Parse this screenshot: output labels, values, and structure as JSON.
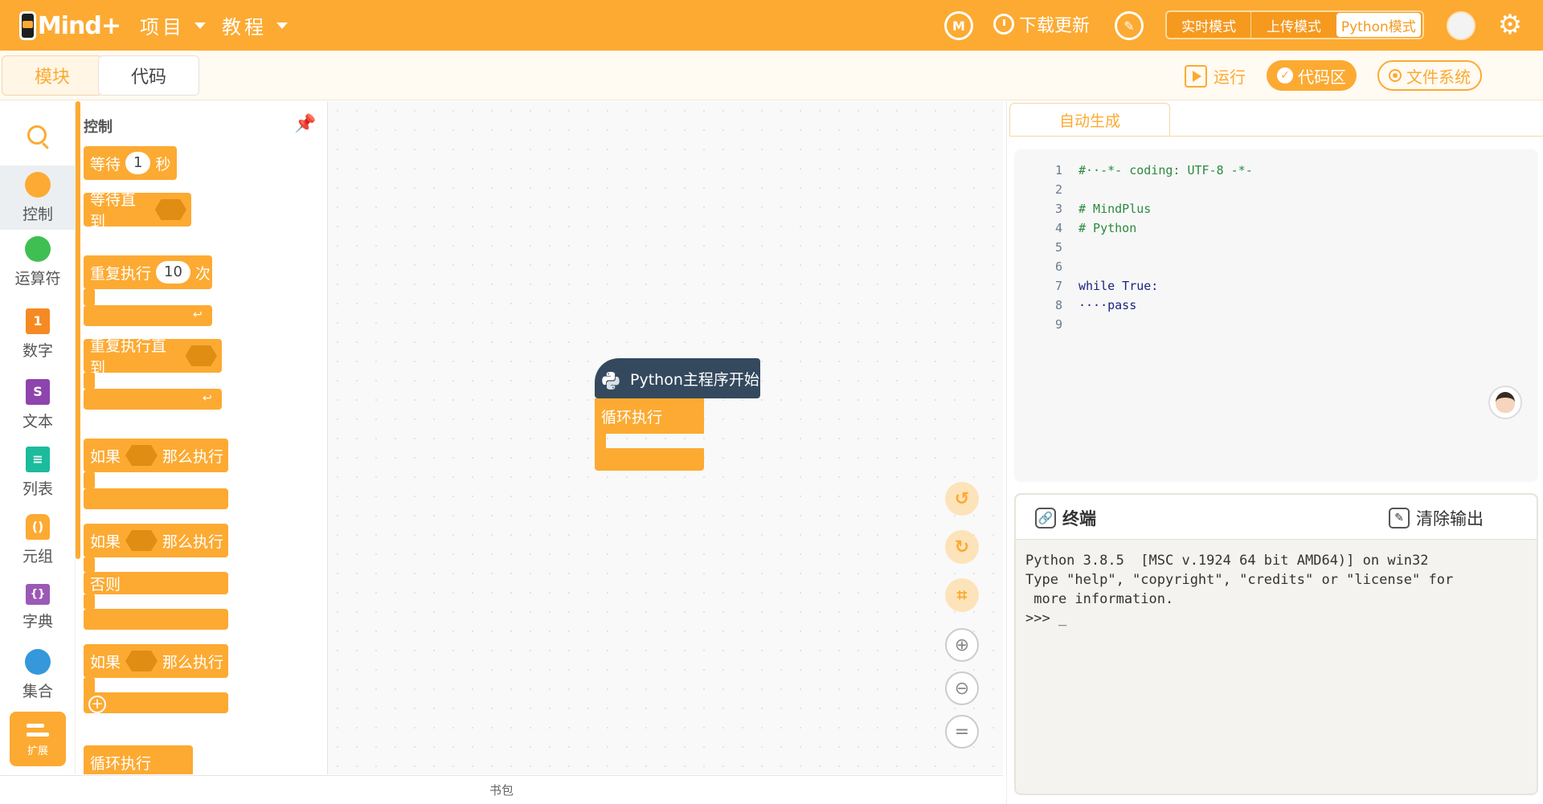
{
  "app": {
    "logo_text": "Mind+",
    "menus": [
      {
        "label": "项目"
      },
      {
        "label": "教程"
      }
    ],
    "update_label": "下载更新",
    "modes": {
      "realtime": "实时模式",
      "upload": "上传模式",
      "python": "Python模式",
      "active": "python"
    }
  },
  "subbar": {
    "tab_blocks": "模块",
    "tab_code": "代码",
    "run_label": "运行",
    "code_area_label": "代码区",
    "filesystem_label": "文件系统"
  },
  "categories": [
    {
      "label": "控制",
      "color": "#fcaa32",
      "active": true
    },
    {
      "label": "运算符",
      "color": "#3fbf52"
    },
    {
      "label": "数字",
      "color": "#f58a22",
      "glyph": "1"
    },
    {
      "label": "文本",
      "color": "#8e44ad",
      "glyph": "S"
    },
    {
      "label": "列表",
      "color": "#1abc9c"
    },
    {
      "label": "元组",
      "color": "#fcaa32"
    },
    {
      "label": "字典",
      "color": "#9b59b6"
    },
    {
      "label": "集合",
      "color": "#3498db"
    }
  ],
  "extension_label": "扩展",
  "palette": {
    "title": "控制",
    "wait": {
      "pre": "等待",
      "value": "1",
      "post": "秒"
    },
    "wait_until": "等待直到",
    "repeat": {
      "pre": "重复执行",
      "value": "10",
      "post": "次"
    },
    "repeat_until": "重复执行直到",
    "if_then": {
      "pre": "如果",
      "post": "那么执行"
    },
    "if_else": {
      "pre": "如果",
      "post": "那么执行",
      "else": "否则"
    },
    "if_then_2": {
      "pre": "如果",
      "post": "那么执行"
    },
    "forever": "循环执行"
  },
  "workspace": {
    "hat_label": "Python主程序开始",
    "loop_label": "循环执行"
  },
  "bookbag_label": "书包",
  "code_panel": {
    "tab_label": "自动生成",
    "lines": [
      {
        "n": "1",
        "text": "#··-*- coding: UTF-8 -*-",
        "kind": "comment"
      },
      {
        "n": "2",
        "text": "",
        "kind": "plain"
      },
      {
        "n": "3",
        "text": "# MindPlus",
        "kind": "comment"
      },
      {
        "n": "4",
        "text": "# Python",
        "kind": "comment"
      },
      {
        "n": "5",
        "text": "",
        "kind": "plain"
      },
      {
        "n": "6",
        "text": "",
        "kind": "plain"
      },
      {
        "n": "7",
        "text": "while True:",
        "kind": "kw"
      },
      {
        "n": "8",
        "text": "····pass",
        "kind": "kw"
      },
      {
        "n": "9",
        "text": "",
        "kind": "plain"
      }
    ]
  },
  "terminal": {
    "title": "终端",
    "clear_label": "清除输出",
    "lines": [
      "Python 3.8.5  [MSC v.1924 64 bit AMD64)] on win32",
      "Type \"help\", \"copyright\", \"credits\" or \"license\" for",
      " more information.",
      ">>> _"
    ]
  },
  "colors": {
    "accent": "#fcaa32",
    "python_block": "#34495e"
  }
}
